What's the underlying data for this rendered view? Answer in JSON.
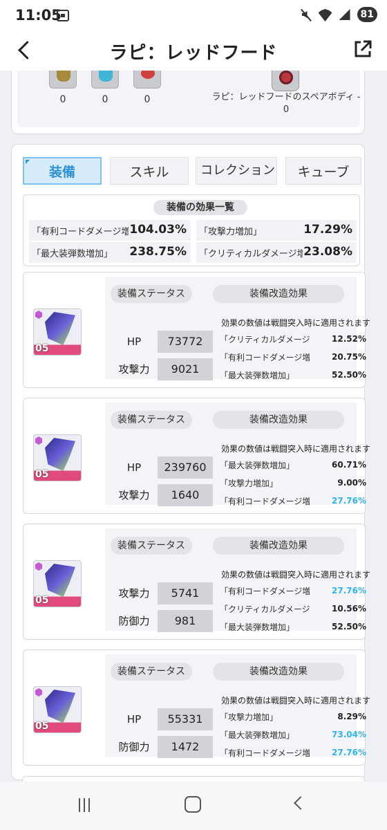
{
  "status": {
    "time": "11:05",
    "battery": "81"
  },
  "header": {
    "title": "ラピ：レッドフード"
  },
  "materials": {
    "items": [
      {
        "count": "0"
      },
      {
        "count": "0"
      },
      {
        "count": "0"
      }
    ],
    "spare_body_label": "ラピ：レッドフードのスペアボディ - 0"
  },
  "tabs": [
    {
      "label": "装備",
      "active": true
    },
    {
      "label": "スキル"
    },
    {
      "label": "コレクション"
    },
    {
      "label": "キューブ"
    }
  ],
  "summary": {
    "title": "装備の効果一覧",
    "effects": [
      {
        "label": "「有利コードダメージ増加",
        "value": "104.03%"
      },
      {
        "label": "「攻撃力増加」",
        "value": "17.29%"
      },
      {
        "label": "「最大装弾数増加」",
        "value": "238.75%"
      },
      {
        "label": "「クリティカルダメージ増",
        "value": "23.08%"
      }
    ]
  },
  "equip_labels": {
    "status_title": "装備ステータス",
    "mod_title": "装備改造効果",
    "mod_header": "効果の数値は戦闘突入時に適用されます"
  },
  "equipment": [
    {
      "level": "05",
      "stats": [
        {
          "name": "HP",
          "value": "73772"
        },
        {
          "name": "攻撃力",
          "value": "9021"
        }
      ],
      "mods": [
        {
          "label": "「クリティカルダメージ増加」",
          "value": "12.52%",
          "color": "#222222"
        },
        {
          "label": "「有利コードダメージ増加」",
          "value": "20.75%",
          "color": "#222222"
        },
        {
          "label": "「最大装弾数増加」",
          "value": "52.50%",
          "color": "#222222"
        }
      ]
    },
    {
      "level": "05",
      "stats": [
        {
          "name": "HP",
          "value": "239760"
        },
        {
          "name": "攻撃力",
          "value": "1640"
        }
      ],
      "mods": [
        {
          "label": "「最大装弾数増加」",
          "value": "60.71%",
          "color": "#222222"
        },
        {
          "label": "「攻撃力増加」",
          "value": "9.00%",
          "color": "#222222"
        },
        {
          "label": "「有利コードダメージ増加」",
          "value": "27.76%",
          "color": "#2fb5e8"
        }
      ]
    },
    {
      "level": "05",
      "stats": [
        {
          "name": "攻撃力",
          "value": "5741"
        },
        {
          "name": "防御力",
          "value": "981"
        }
      ],
      "mods": [
        {
          "label": "「有利コードダメージ増加」",
          "value": "27.76%",
          "color": "#2fb5e8"
        },
        {
          "label": "「クリティカルダメージ増加」",
          "value": "10.56%",
          "color": "#222222"
        },
        {
          "label": "「最大装弾数増加」",
          "value": "52.50%",
          "color": "#222222"
        }
      ]
    },
    {
      "level": "05",
      "stats": [
        {
          "name": "HP",
          "value": "55331"
        },
        {
          "name": "防御力",
          "value": "1472"
        }
      ],
      "mods": [
        {
          "label": "「攻撃力増加」",
          "value": "8.29%",
          "color": "#222222"
        },
        {
          "label": "「最大装弾数増加」",
          "value": "73.04%",
          "color": "#2fb5e8"
        },
        {
          "label": "「有利コードダメージ増加」",
          "value": "27.76%",
          "color": "#2fb5e8"
        }
      ]
    }
  ]
}
